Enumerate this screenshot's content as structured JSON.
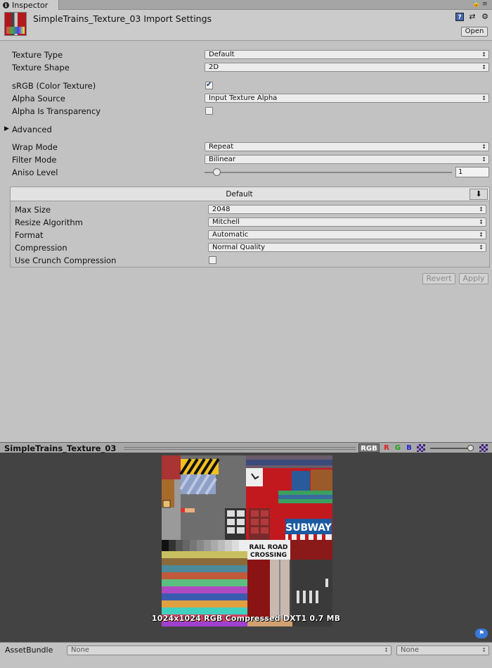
{
  "tab": {
    "label": "Inspector"
  },
  "header": {
    "title": "SimpleTrains_Texture_03 Import Settings",
    "open_label": "Open"
  },
  "settings": {
    "texture_type": {
      "label": "Texture Type",
      "value": "Default"
    },
    "texture_shape": {
      "label": "Texture Shape",
      "value": "2D"
    },
    "srgb": {
      "label": "sRGB (Color Texture)",
      "checked": true
    },
    "alpha_source": {
      "label": "Alpha Source",
      "value": "Input Texture Alpha"
    },
    "alpha_transparency": {
      "label": "Alpha Is Transparency",
      "checked": false
    },
    "advanced": {
      "label": "Advanced"
    },
    "wrap_mode": {
      "label": "Wrap Mode",
      "value": "Repeat"
    },
    "filter_mode": {
      "label": "Filter Mode",
      "value": "Bilinear"
    },
    "aniso": {
      "label": "Aniso Level",
      "value": "1",
      "slider_fraction": 0.05
    }
  },
  "platform": {
    "title": "Default",
    "max_size": {
      "label": "Max Size",
      "value": "2048"
    },
    "resize": {
      "label": "Resize Algorithm",
      "value": "Mitchell"
    },
    "format": {
      "label": "Format",
      "value": "Automatic"
    },
    "compression": {
      "label": "Compression",
      "value": "Normal Quality"
    },
    "crunch": {
      "label": "Use Crunch Compression",
      "checked": false
    }
  },
  "buttons": {
    "revert": "Revert",
    "apply": "Apply"
  },
  "preview": {
    "title": "SimpleTrains_Texture_03",
    "channels": {
      "rgb": "RGB",
      "r": "R",
      "g": "G",
      "b": "B"
    },
    "info": "1024x1024  RGB Compressed DXT1   0.7 MB",
    "texture_text": {
      "subway": "SUBWAY",
      "railroad_1": "RAIL ROAD",
      "railroad_2": "CROSSING"
    }
  },
  "asset_bundle": {
    "label": "AssetBundle",
    "name": "None",
    "variant": "None"
  },
  "colors": {
    "panel": "#c2c2c2",
    "preview_bg": "#434343",
    "accent_blue": "#3978d8"
  }
}
